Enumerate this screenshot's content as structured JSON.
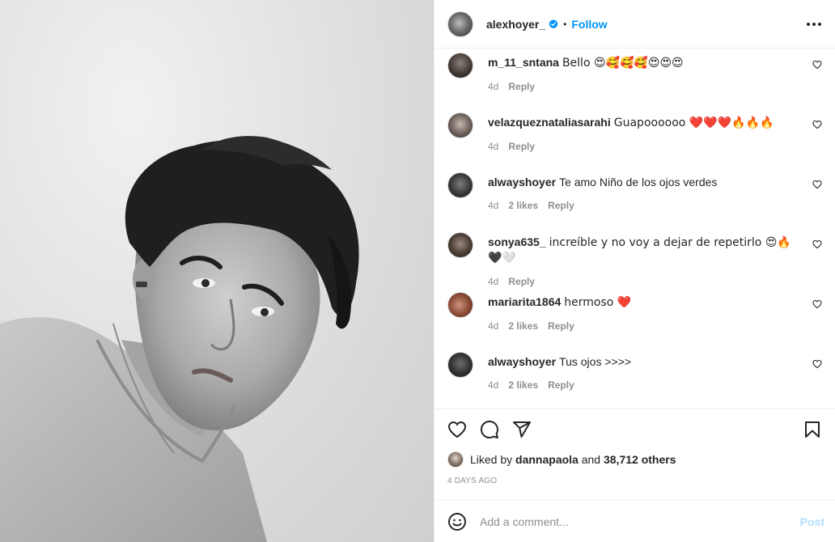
{
  "post": {
    "owner": {
      "username": "alexhoyer_",
      "follow_label": "Follow",
      "separator": "•"
    },
    "comments": [
      {
        "username": "m_11_sntana",
        "text": "Bello 😍🥰🥰🥰😍😍😍",
        "time": "4d",
        "likes": "",
        "reply": "Reply"
      },
      {
        "username": "velazqueznataliasarahi",
        "text": "Guapoooooo ❤️❤️❤️🔥🔥🔥",
        "time": "4d",
        "likes": "",
        "reply": "Reply"
      },
      {
        "username": "alwayshoyer",
        "text": "Te amo Niño de los ojos verdes",
        "time": "4d",
        "likes": "2 likes",
        "reply": "Reply"
      },
      {
        "username": "sonya635_",
        "text": "increíble y no voy a dejar de repetirlo 😍🔥🖤🤍",
        "time": "4d",
        "likes": "",
        "reply": "Reply"
      },
      {
        "username": "mariarita1864",
        "text": "hermoso ❤️",
        "time": "4d",
        "likes": "2 likes",
        "reply": "Reply"
      },
      {
        "username": "alwayshoyer",
        "text": "Tus ojos >>>>",
        "time": "4d",
        "likes": "2 likes",
        "reply": "Reply"
      }
    ],
    "liked_by": {
      "prefix": "Liked by",
      "user": "dannapaola",
      "and": "and",
      "others": "38,712 others"
    },
    "timestamp": "4 DAYS AGO",
    "add_comment": {
      "placeholder": "Add a comment...",
      "post_label": "Post"
    }
  },
  "colors": {
    "accent": "#0095f6",
    "post_disabled": "#b2dffc",
    "text": "#262626",
    "muted": "#8e8e8e"
  },
  "icons": [
    "verified-badge-icon",
    "more-options-icon",
    "heart-icon",
    "comment-icon",
    "share-icon",
    "bookmark-icon",
    "emoji-icon"
  ]
}
